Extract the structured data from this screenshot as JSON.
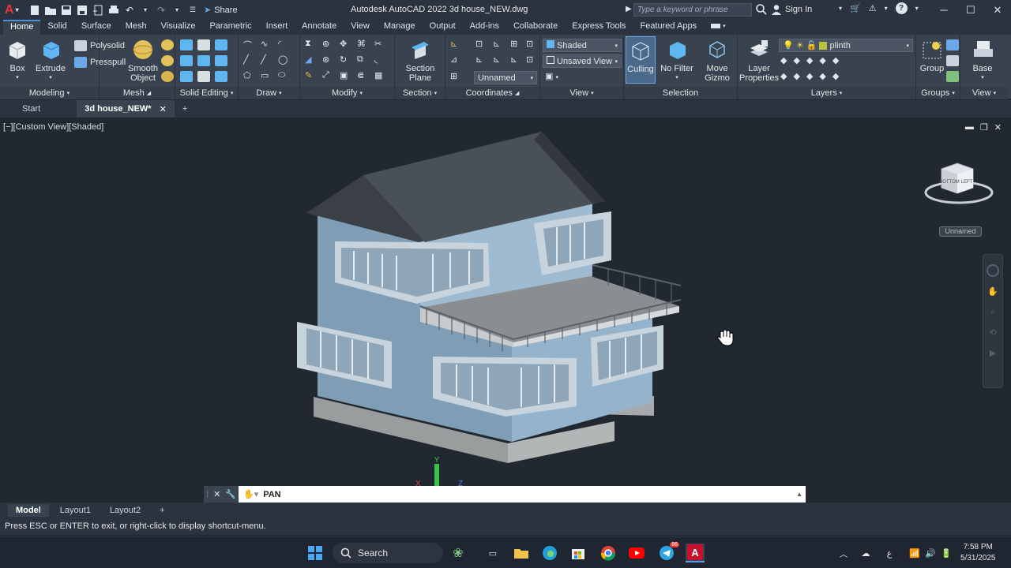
{
  "app": {
    "title": "Autodesk AutoCAD 2022    3d house_NEW.dwg",
    "share_label": "Share",
    "search_placeholder": "Type a keyword or phrase",
    "signin_label": "Sign In"
  },
  "ribbon_tabs": [
    "Home",
    "Solid",
    "Surface",
    "Mesh",
    "Visualize",
    "Parametric",
    "Insert",
    "Annotate",
    "View",
    "Manage",
    "Output",
    "Add-ins",
    "Collaborate",
    "Express Tools",
    "Featured Apps"
  ],
  "ribbon": {
    "modeling": {
      "title": "Modeling",
      "box": "Box",
      "extrude": "Extrude",
      "polysolid": "Polysolid",
      "presspull": "Presspull"
    },
    "mesh": {
      "title": "Mesh",
      "smooth_object": "Smooth Object"
    },
    "solid_editing": {
      "title": "Solid Editing"
    },
    "draw": {
      "title": "Draw"
    },
    "modify": {
      "title": "Modify"
    },
    "section": {
      "title": "Section",
      "section_plane": "Section Plane"
    },
    "coordinates": {
      "title": "Coordinates",
      "ucs_value": "Unnamed"
    },
    "view": {
      "title": "View",
      "visual_style": "Shaded",
      "saved_view": "Unsaved View"
    },
    "selection": {
      "title": "Selection",
      "culling": "Culling",
      "no_filter": "No Filter",
      "move_gizmo": "Move Gizmo"
    },
    "layers": {
      "title": "Layers",
      "layer_properties": "Layer Properties",
      "current_layer": "plinth"
    },
    "groups": {
      "title": "Groups",
      "group": "Group"
    },
    "view2": {
      "title": "View",
      "base": "Base"
    }
  },
  "file_tabs": {
    "start": "Start",
    "active": "3d house_NEW*"
  },
  "viewport": {
    "label": "[−][Custom View][Shaded]",
    "viewcube_face": "BOTTOM",
    "viewcube_side": "LEFT",
    "ucs_name": "Unnamed"
  },
  "command": {
    "current": "PAN"
  },
  "layout_tabs": [
    "Model",
    "Layout1",
    "Layout2"
  ],
  "status_message": "Press ESC or ENTER to exit, or right-click to display shortcut-menu.",
  "taskbar": {
    "search_label": "Search",
    "time": "7:58 PM",
    "date": "5/31/2025",
    "telegram_badge": "86",
    "lang_indicator": "ع"
  },
  "colors": {
    "accent": "#4a90d9",
    "ribbon_bg": "#39434f",
    "title_bg": "#2b3340",
    "viewport_bg": "#212830"
  }
}
